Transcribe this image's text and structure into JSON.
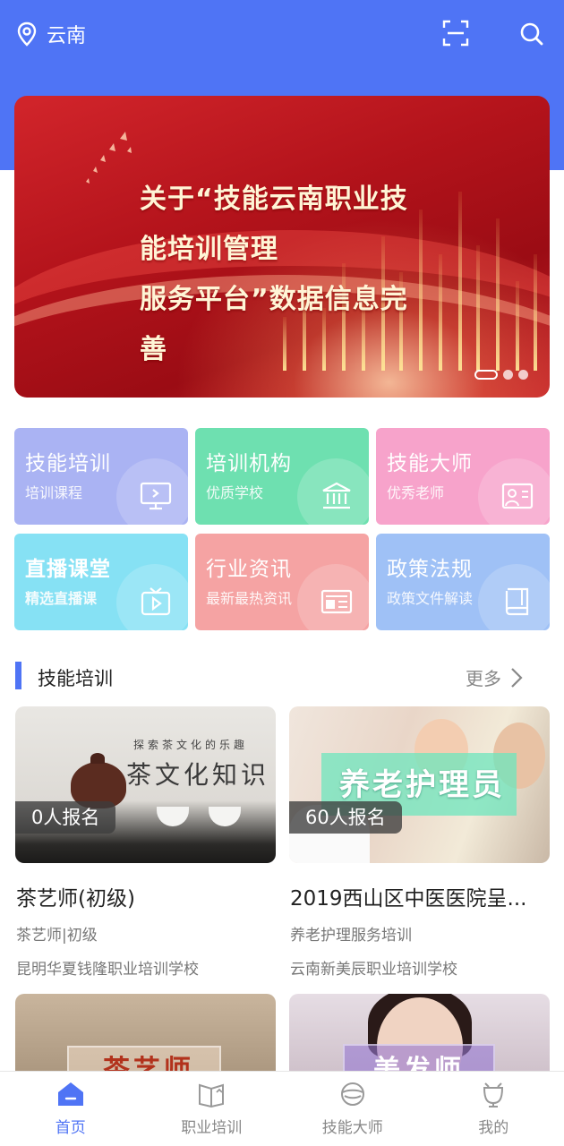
{
  "header": {
    "location": "云南",
    "color": "#4f74f5"
  },
  "banner": {
    "title_line1": "关于“技能云南职业技能培训管理",
    "title_line2": "服务平台”数据信息完善",
    "slide_count": 3,
    "active_slide": 1
  },
  "categories": [
    {
      "title": "技能培训",
      "subtitle": "培训课程",
      "icon": "monitor-icon",
      "color": "#aab3f3"
    },
    {
      "title": "培训机构",
      "subtitle": "优质学校",
      "icon": "institution-icon",
      "color": "#6ee0b0"
    },
    {
      "title": "技能大师",
      "subtitle": "优秀老师",
      "icon": "teacher-icon",
      "color": "#f7a3cb"
    },
    {
      "title": "直播课堂",
      "subtitle": "精选直播课",
      "icon": "live-tv-icon",
      "color": "#86e1f4"
    },
    {
      "title": "行业资讯",
      "subtitle": "最新最热资讯",
      "icon": "news-icon",
      "color": "#f5a3a3"
    },
    {
      "title": "政策法规",
      "subtitle": "政策文件解读",
      "icon": "policy-book-icon",
      "color": "#9fc1f6"
    }
  ],
  "section": {
    "title": "技能培训",
    "more_label": "更多"
  },
  "courses": [
    {
      "badge": "0人报名",
      "name": "茶艺师(初级)",
      "category": "茶艺师|初级",
      "school": "昆明华夏钱隆职业培训学校",
      "image_text_small": "探索茶文化的乐趣",
      "image_text_large": "茶文化知识"
    },
    {
      "badge": "60人报名",
      "name": "2019西山区中医医院呈...",
      "category": "养老护理服务培训",
      "school": "云南新美辰职业培训学校",
      "image_text_large": "养老护理员"
    },
    {
      "image_text_large": "茶艺师"
    },
    {
      "image_text_large": "美发师"
    }
  ],
  "bottom_nav": [
    {
      "label": "首页",
      "icon": "home-icon",
      "active": true
    },
    {
      "label": "职业培训",
      "icon": "book-icon",
      "active": false
    },
    {
      "label": "技能大师",
      "icon": "master-icon",
      "active": false
    },
    {
      "label": "我的",
      "icon": "profile-icon",
      "active": false
    }
  ]
}
